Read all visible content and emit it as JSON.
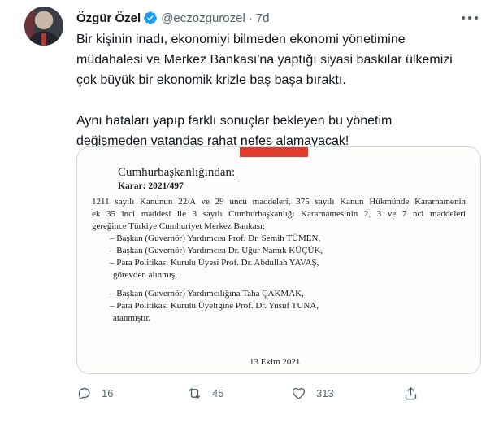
{
  "user": {
    "name": "Özgür Özel",
    "handle": "@eczozgurozel",
    "separator": "·",
    "time": "7d"
  },
  "tweet": {
    "lines": [
      "Bir kişinin inadı, ekonomiyi bilmeden ekonomi yönetimine",
      "müdahalesi ve Merkez Bankası'na yaptığı siyasi baskılar ülkemizi",
      "çok büyük bir ekonomik krizle baş başa bıraktı.",
      "Aynı hataları yapıp farklı sonuçlar bekleyen bu yönetim",
      "değişmeden vatandaş rahat nefes alamayacak!"
    ]
  },
  "document": {
    "heading": "Cumhurbaşkanlığından:",
    "decision": "Karar: 2021/497",
    "para": [
      "1211 sayılı Kanunun 22/A ve 29 uncu maddeleri, 375 sayılı Kanun Hükmünde Kararnamenin",
      "ek 35 inci maddesi ile 3 sayılı Cumhurbaşkanlığı Kararnamesinin 2, 3 ve 7 nci maddeleri",
      "gereğince Türkiye Cumhuriyet Merkez Bankası;"
    ],
    "dismissed": [
      "–  Başkan (Guvernör) Yardımcısı Prof. Dr. Semih TÜMEN,",
      "–  Başkan (Guvernör) Yardımcısı Dr. Uğur Namık KÜÇÜK,",
      "–  Para Politikası Kurulu Üyesi Prof. Dr. Abdullah YAVAŞ,"
    ],
    "dismissed_end": "görevden alınmış,",
    "appointed": [
      "–  Başkan (Guvernör) Yardımcılığına Taha ÇAKMAK,",
      "–  Para Politikası Kurulu Üyeliğine Prof. Dr. Yusuf TUNA,"
    ],
    "appointed_end": "atanmıştır.",
    "date": "13 Ekim 2021"
  },
  "actions": {
    "reply_count": "16",
    "retweet_count": "45",
    "like_count": "313"
  },
  "icons": {
    "verified": "verified-badge-icon",
    "more": "more-options-icon",
    "reply": "reply-icon",
    "retweet": "retweet-icon",
    "like": "heart-icon",
    "share": "share-icon"
  },
  "colors": {
    "verified": "#1d9bf0",
    "secondary_text": "#536471",
    "document_tab": "#e03b2d"
  }
}
